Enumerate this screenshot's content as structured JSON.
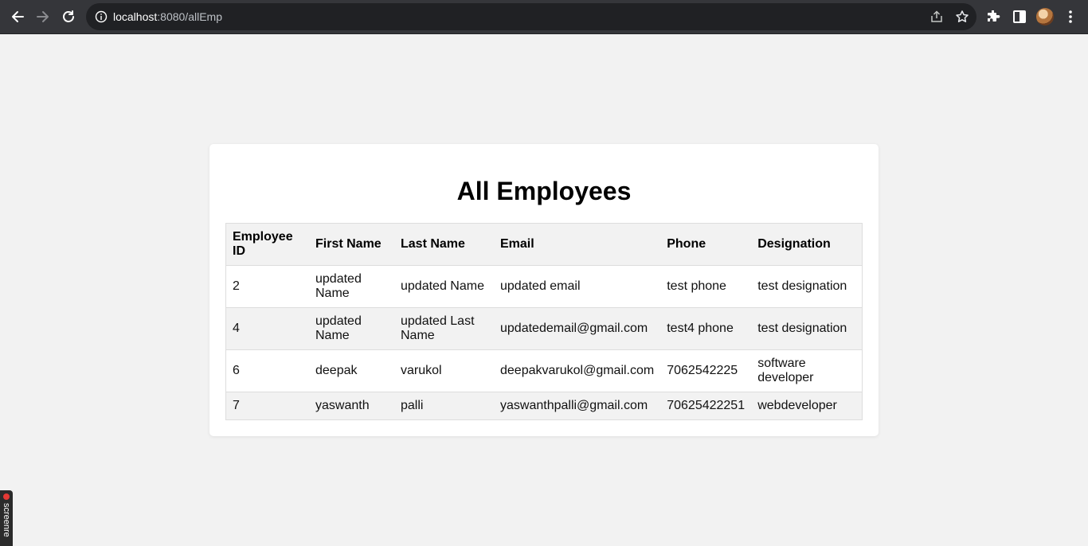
{
  "browser": {
    "url_host": "localhost",
    "url_rest": ":8080/allEmp",
    "icons": [
      "back-icon",
      "forward-icon",
      "reload-icon",
      "info-icon",
      "share-icon",
      "star-icon",
      "extensions-icon",
      "sidebar-icon",
      "profile-avatar",
      "menu-icon"
    ]
  },
  "page": {
    "title": "All Employees"
  },
  "table": {
    "headers": [
      "Employee ID",
      "First Name",
      "Last Name",
      "Email",
      "Phone",
      "Designation"
    ],
    "rows": [
      [
        "2",
        "updated Name",
        "updated Name",
        "updated email",
        "test phone",
        "test designation"
      ],
      [
        "4",
        "updated Name",
        "updated Last Name",
        "updatedemail@gmail.com",
        "test4 phone",
        "test designation"
      ],
      [
        "6",
        "deepak",
        "varukol",
        "deepakvarukol@gmail.com",
        "7062542225",
        "software developer"
      ],
      [
        "7",
        "yaswanth",
        "palli",
        "yaswanthpalli@gmail.com",
        "70625422251",
        "webdeveloper"
      ]
    ]
  },
  "recorder": {
    "label": "screenre"
  }
}
